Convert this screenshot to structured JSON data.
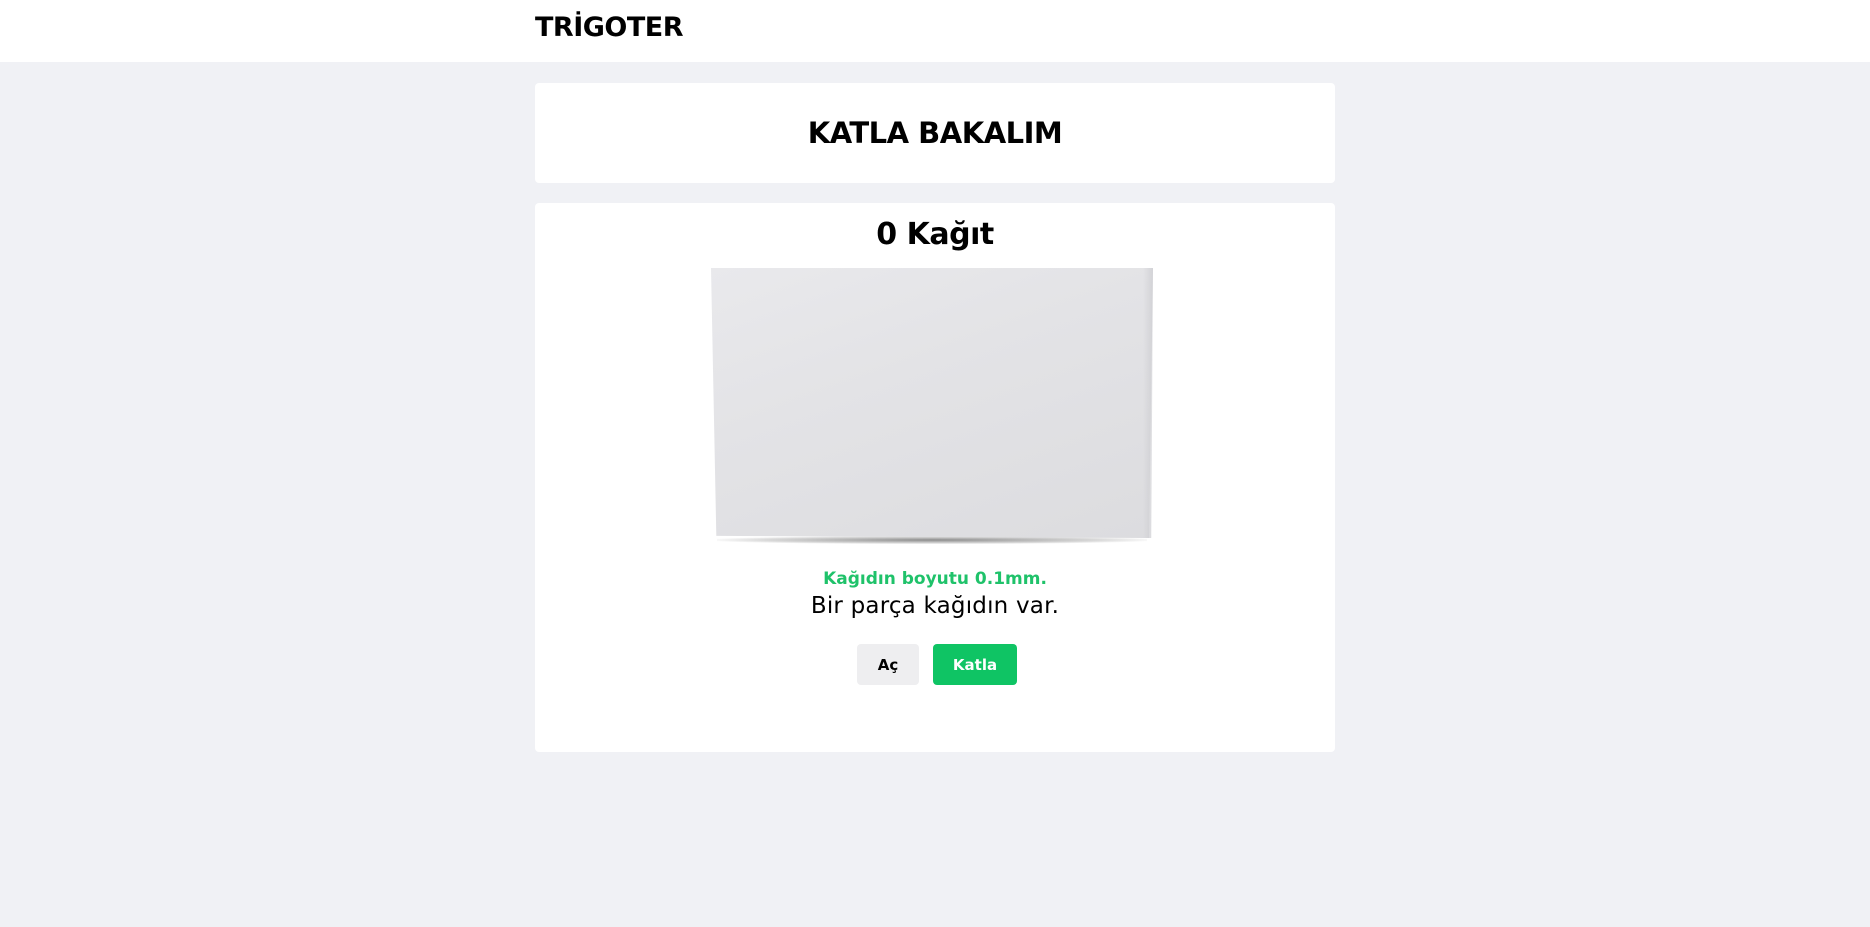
{
  "header": {
    "brand": "TRİGOTER"
  },
  "title_card": {
    "title": "KATLA BAKALIM"
  },
  "paper_panel": {
    "counter": "0 Kağıt",
    "size_text": "Kağıdın boyutu 0.1mm.",
    "description": "Bir parça kağıdın var."
  },
  "actions": {
    "open_label": "Aç",
    "fold_label": "Katla"
  },
  "colors": {
    "background": "#f0f1f5",
    "accent_green": "#0fc464",
    "size_text_green": "#1fc26a",
    "secondary_button": "#eeeef0"
  }
}
